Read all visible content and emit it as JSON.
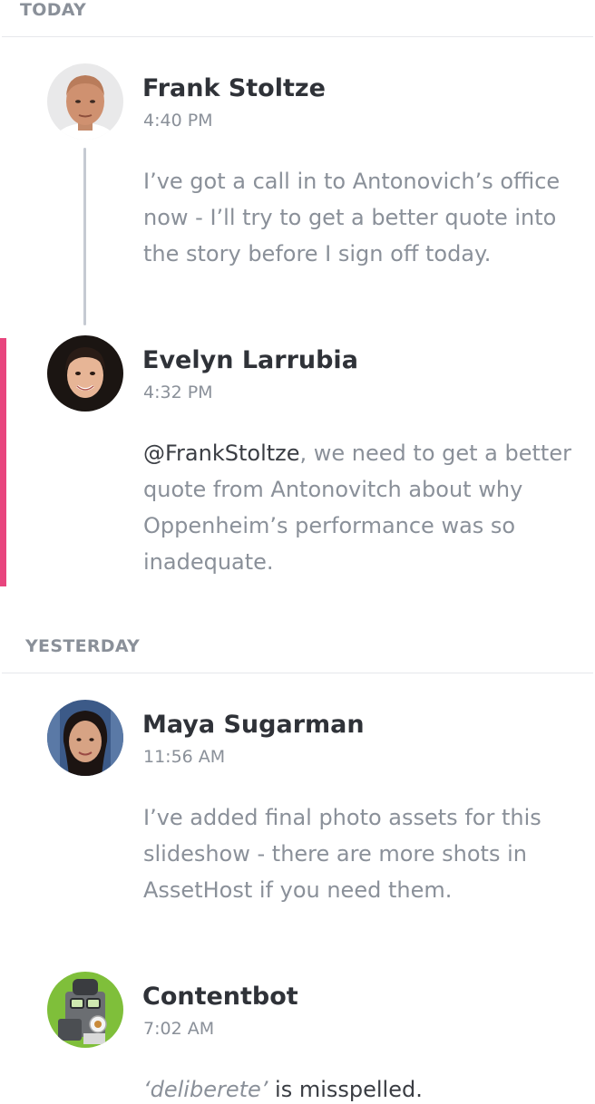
{
  "sections": {
    "today": {
      "label": "TODAY"
    },
    "yesterday": {
      "label": "YESTERDAY"
    }
  },
  "comments": [
    {
      "author": "Frank Stoltze",
      "time": "4:40 PM",
      "text": "I’ve got a call in to Antonovich’s office now - I’ll try to get a better quote into the story before I sign off today.",
      "avatar_icon": "person-avatar"
    },
    {
      "author": "Evelyn Larrubia",
      "time": "4:32 PM",
      "mention": "@FrankStoltze",
      "text": ", we need to get a better quote from Antonovitch about why Oppenheim’s performance was so inadequate.",
      "avatar_icon": "person-avatar",
      "highlight_color": "#e8457e"
    },
    {
      "author": "Maya Sugarman",
      "time": "11:56 AM",
      "text": "I’ve added final photo assets for this slideshow - there are more shots in AssetHost if you need them.",
      "avatar_icon": "person-avatar"
    },
    {
      "author": "Contentbot",
      "time": "7:02 AM",
      "quoted": "‘deliberete’",
      "text": " is misspelled.",
      "avatar_icon": "robot-avatar"
    }
  ]
}
